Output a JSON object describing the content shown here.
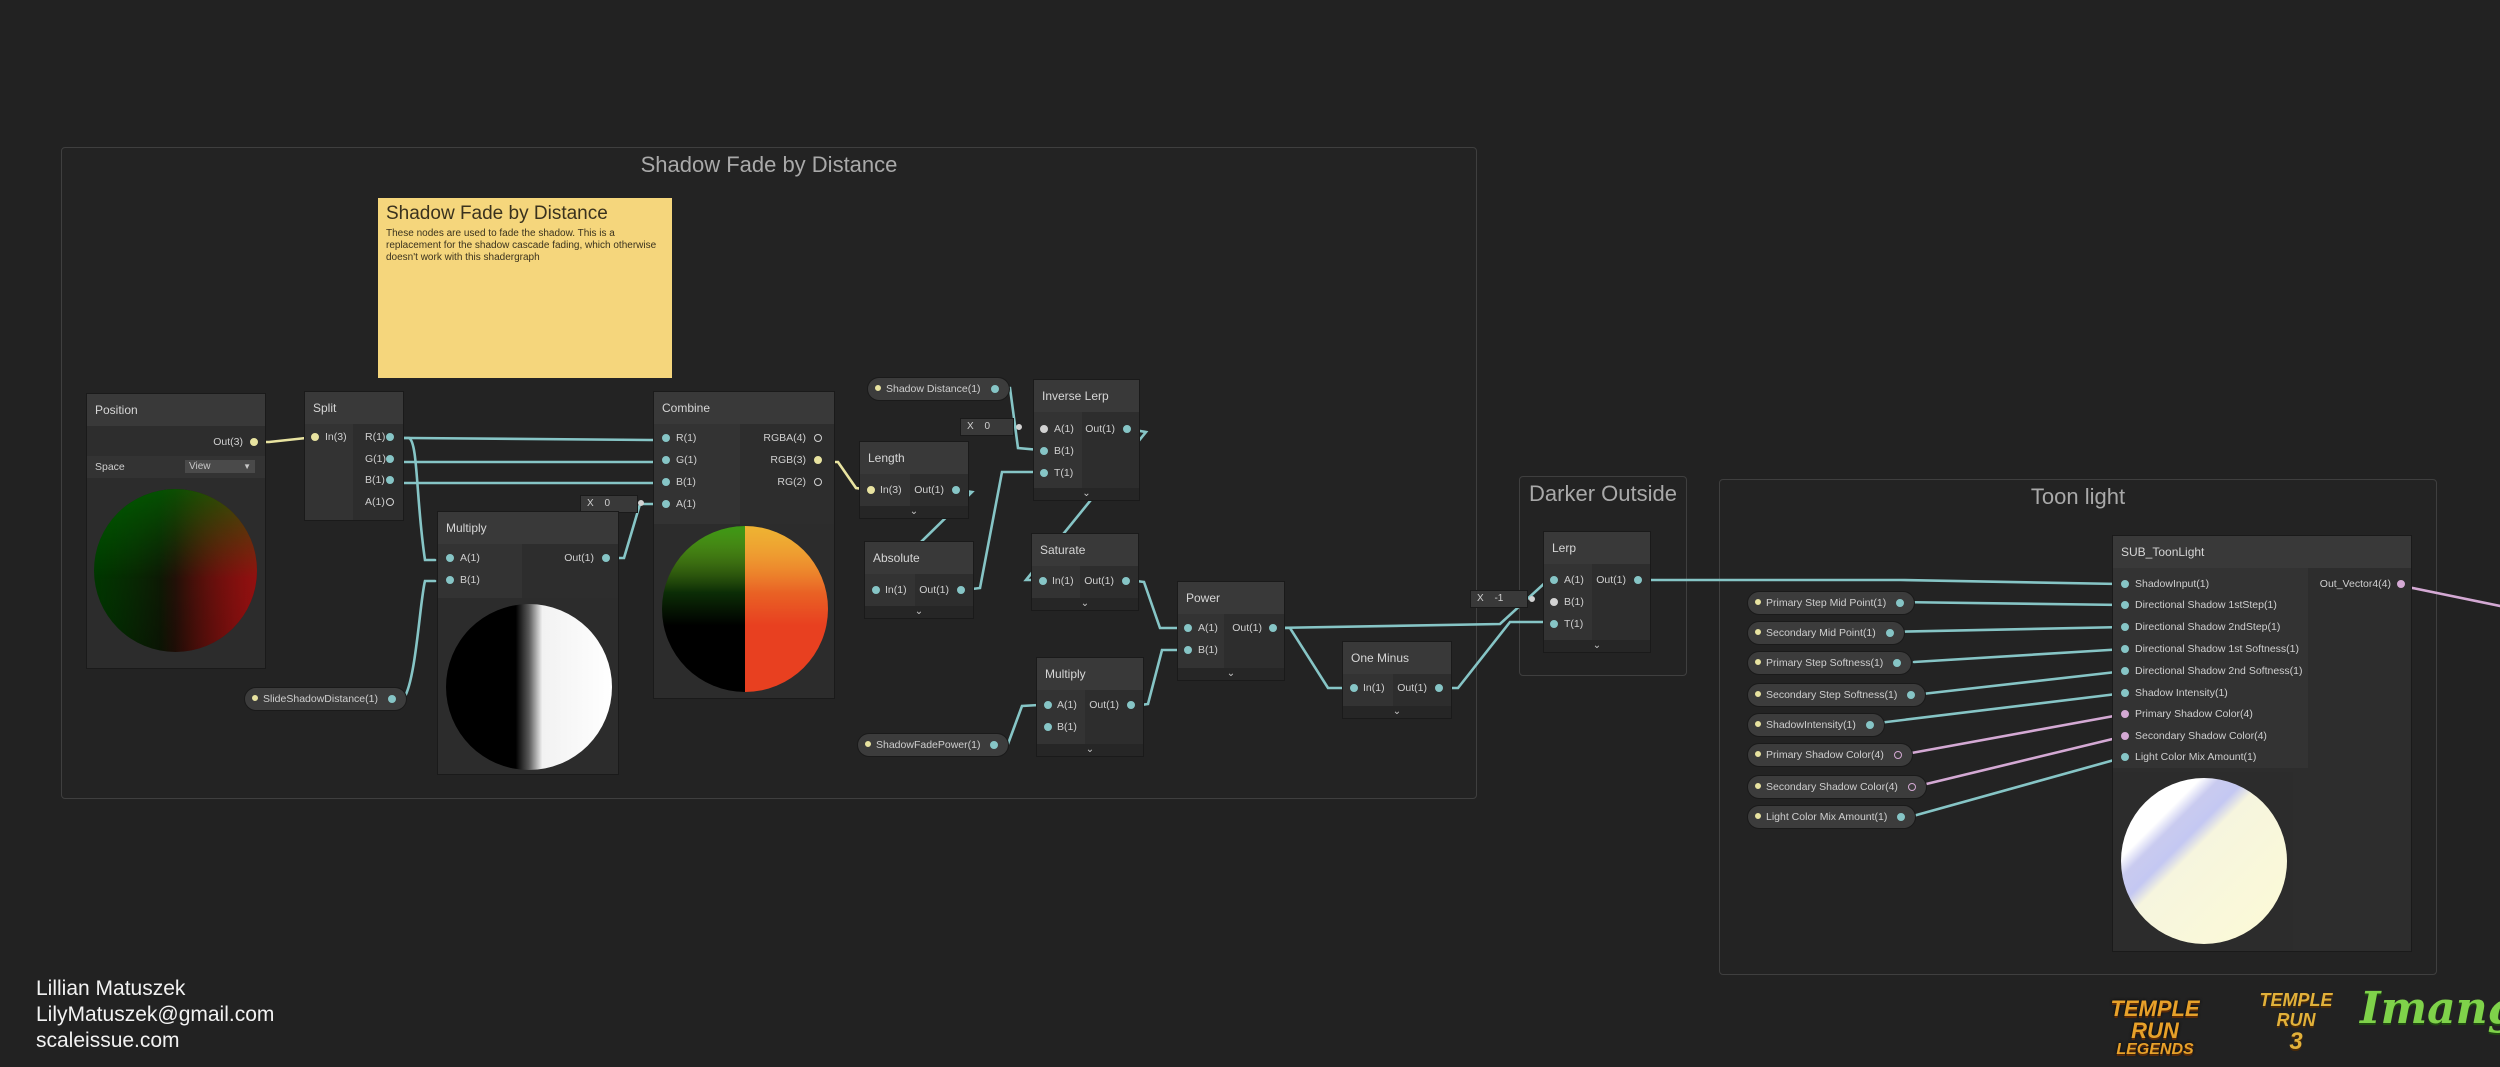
{
  "groups": {
    "shadow_fade": {
      "title": "Shadow Fade by Distance"
    },
    "darker_outside": {
      "title": "Darker Outside"
    },
    "toon_light": {
      "title": "Toon light"
    }
  },
  "sticky_note": {
    "title": "Shadow Fade by Distance",
    "body": "These nodes are used to fade the shadow. This is a replacement for the shadow cascade fading, which otherwise doesn't work with this shadergraph"
  },
  "nodes": {
    "position": {
      "title": "Position",
      "out": "Out(3)",
      "space_label": "Space",
      "space_value": "View"
    },
    "split": {
      "title": "Split",
      "in": "In(3)",
      "outs": [
        "R(1)",
        "G(1)",
        "B(1)",
        "A(1)"
      ]
    },
    "combine": {
      "title": "Combine",
      "ins": [
        "R(1)",
        "G(1)",
        "B(1)",
        "A(1)"
      ],
      "outs": [
        "RGBA(4)",
        "RGB(3)",
        "RG(2)"
      ],
      "a_default_label": "X",
      "a_default_value": "0"
    },
    "multiply1": {
      "title": "Multiply",
      "ins": [
        "A(1)",
        "B(1)"
      ],
      "out": "Out(1)"
    },
    "length": {
      "title": "Length",
      "in": "In(3)",
      "out": "Out(1)"
    },
    "absolute": {
      "title": "Absolute",
      "in": "In(1)",
      "out": "Out(1)"
    },
    "inverse_lerp": {
      "title": "Inverse Lerp",
      "ins": [
        "A(1)",
        "B(1)",
        "T(1)"
      ],
      "out": "Out(1)",
      "a_default_label": "X",
      "a_default_value": "0"
    },
    "saturate": {
      "title": "Saturate",
      "in": "In(1)",
      "out": "Out(1)"
    },
    "multiply2": {
      "title": "Multiply",
      "ins": [
        "A(1)",
        "B(1)"
      ],
      "out": "Out(1)"
    },
    "power": {
      "title": "Power",
      "ins": [
        "A(1)",
        "B(1)"
      ],
      "out": "Out(1)"
    },
    "one_minus": {
      "title": "One Minus",
      "in": "In(1)",
      "out": "Out(1)"
    },
    "lerp": {
      "title": "Lerp",
      "ins": [
        "A(1)",
        "B(1)",
        "T(1)"
      ],
      "out": "Out(1)",
      "b_default_label": "X",
      "b_default_value": "-1"
    },
    "sub_toonlight": {
      "title": "SUB_ToonLight",
      "ins": [
        "ShadowInput(1)",
        "Directional Shadow 1stStep(1)",
        "Directional Shadow 2ndStep(1)",
        "Directional Shadow 1st Softness(1)",
        "Directional Shadow 2nd Softness(1)",
        "Shadow Intensity(1)",
        "Primary Shadow Color(4)",
        "Secondary Shadow Color(4)",
        "Light Color Mix Amount(1)"
      ],
      "out": "Out_Vector4(4)"
    }
  },
  "properties": {
    "shadow_distance": "Shadow Distance(1)",
    "slide_shadow_distance": "SlideShadowDistance(1)",
    "shadow_fade_power": "ShadowFadePower(1)",
    "toon": [
      "Primary Step Mid Point(1)",
      "Secondary Mid Point(1)",
      "Primary Step Softness(1)",
      "Secondary Step Softness(1)",
      "ShadowIntensity(1)",
      "Primary Shadow Color(4)",
      "Secondary Shadow Color(4)",
      "Light Color Mix Amount(1)"
    ]
  },
  "credits": {
    "name": "Lillian Matuszek",
    "email": "LilyMatuszek@gmail.com",
    "site": "scaleissue.com"
  },
  "logos": {
    "temple_run_legends_top": "TEMPLE RUN",
    "temple_run_legends_bottom": "LEGENDS",
    "temple_run_3_top": "TEMPLE RUN",
    "temple_run_3_bottom": "3",
    "imangi": "Imangi"
  },
  "colors": {
    "background": "#222222",
    "node_header": "#393939",
    "node_body": "#2d2d2d",
    "wire_float": "#86c5c6",
    "wire_vector3": "#e8e3a0",
    "wire_vector4": "#d4a9d4",
    "sticky": "#f5d67c"
  }
}
